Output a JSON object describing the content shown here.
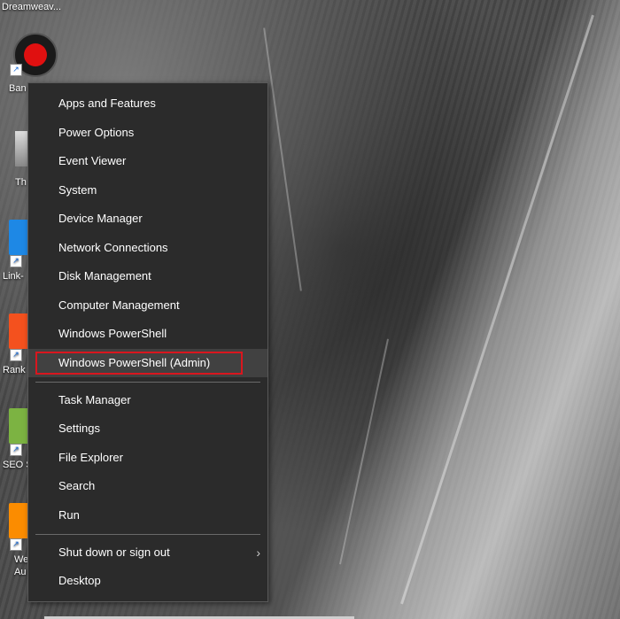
{
  "desktop": {
    "top_label": "Dreamweav...",
    "icons": [
      {
        "label": "Ban"
      },
      {
        "label": "Th"
      },
      {
        "label": "Link-"
      },
      {
        "label": "Rank"
      },
      {
        "label": "SEO S"
      },
      {
        "label": "We"
      },
      {
        "label": "Au"
      }
    ],
    "colors": {
      "link_tile": "#1e88e5",
      "rank_tile": "#f4511e",
      "seo_tile": "#7cb342",
      "web_tile": "#fb8c00"
    }
  },
  "menu": {
    "group1": [
      "Apps and Features",
      "Power Options",
      "Event Viewer",
      "System",
      "Device Manager",
      "Network Connections",
      "Disk Management",
      "Computer Management",
      "Windows PowerShell",
      "Windows PowerShell (Admin)"
    ],
    "group2": [
      "Task Manager",
      "Settings",
      "File Explorer",
      "Search",
      "Run"
    ],
    "group3": [
      "Shut down or sign out",
      "Desktop"
    ],
    "highlight_color": "#d9161e",
    "submenu_chevron_icon": "chevron-right-icon"
  }
}
